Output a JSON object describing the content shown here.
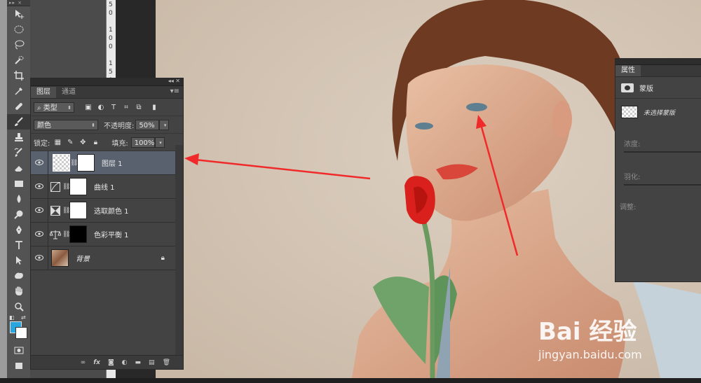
{
  "toolbar": {
    "tools": [
      "move-tool-icon",
      "elliptical-marquee-icon",
      "lasso-icon",
      "quick-selection-icon",
      "crop-icon",
      "eyedropper-icon",
      "healing-brush-icon",
      "brush-icon",
      "clone-stamp-icon",
      "history-brush-icon",
      "eraser-icon",
      "gradient-icon",
      "blur-icon",
      "dodge-icon",
      "pen-icon",
      "type-icon",
      "path-selection-icon",
      "shape-icon",
      "hand-icon",
      "zoom-icon"
    ],
    "active_tool": "brush-icon",
    "foreground_color": "#2aa6df",
    "background_color": "#ffffff"
  },
  "ruler": {
    "digits": [
      "5",
      "0",
      "1",
      "0",
      "0",
      "1",
      "5",
      "0"
    ]
  },
  "layers_panel": {
    "tabs": [
      {
        "label": "图层"
      },
      {
        "label": "通道"
      }
    ],
    "filter_label": "类型",
    "blend_mode": "颜色",
    "opacity_label": "不透明度:",
    "opacity_value": "50%",
    "lock_label": "锁定:",
    "fill_label": "填充:",
    "fill_value": "100%",
    "layers": [
      {
        "name": "图层 1",
        "mask": "white",
        "active": true,
        "adjustment": "none"
      },
      {
        "name": "曲线 1",
        "mask": "white",
        "active": false,
        "adjustment": "curves-icon"
      },
      {
        "name": "选取颜色 1",
        "mask": "white",
        "active": false,
        "adjustment": "selective-color-icon"
      },
      {
        "name": "色彩平衡 1",
        "mask": "black",
        "active": false,
        "adjustment": "color-balance-icon"
      },
      {
        "name": "背景",
        "mask": "none",
        "active": false,
        "adjustment": "none",
        "locked": true
      }
    ],
    "footer_icons": [
      "link-icon",
      "fx-icon",
      "add-mask-icon",
      "adjustment-layer-icon",
      "new-group-icon",
      "new-layer-icon",
      "trash-icon"
    ],
    "footer_fx": "fx"
  },
  "properties_panel": {
    "tab": "属性",
    "mask_label": "蒙版",
    "no_mask_selected": "未选择蒙版",
    "density_label": "浓度:",
    "feather_label": "羽化:",
    "adjust_label": "调整:"
  },
  "watermark": {
    "brand": "Bai 经验",
    "url": "jingyan.baidu.com"
  },
  "arrow_color": "#f02a2a"
}
